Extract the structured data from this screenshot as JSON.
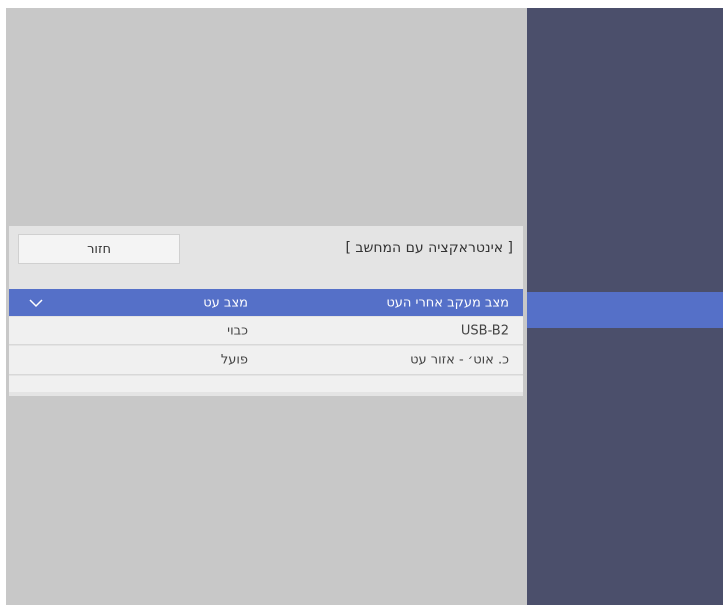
{
  "dialog": {
    "title": "[ אינטראקציה עם המחשב ]",
    "back_label": "חזור",
    "rows": [
      {
        "label": "מצב מעקב אחרי העט",
        "value": "מצב עט",
        "icon": "chevron-down-icon"
      },
      {
        "label": "USB-B2",
        "value": "כבוי"
      },
      {
        "label": "כ. אוט׳ - אזור עט",
        "value": "פועל"
      }
    ]
  },
  "colors": {
    "background": "#c8c8c8",
    "sidebar": "#4b4f6b",
    "highlight": "#5570c8",
    "dialog": "#e4e4e4",
    "row": "#f0f0f0"
  }
}
